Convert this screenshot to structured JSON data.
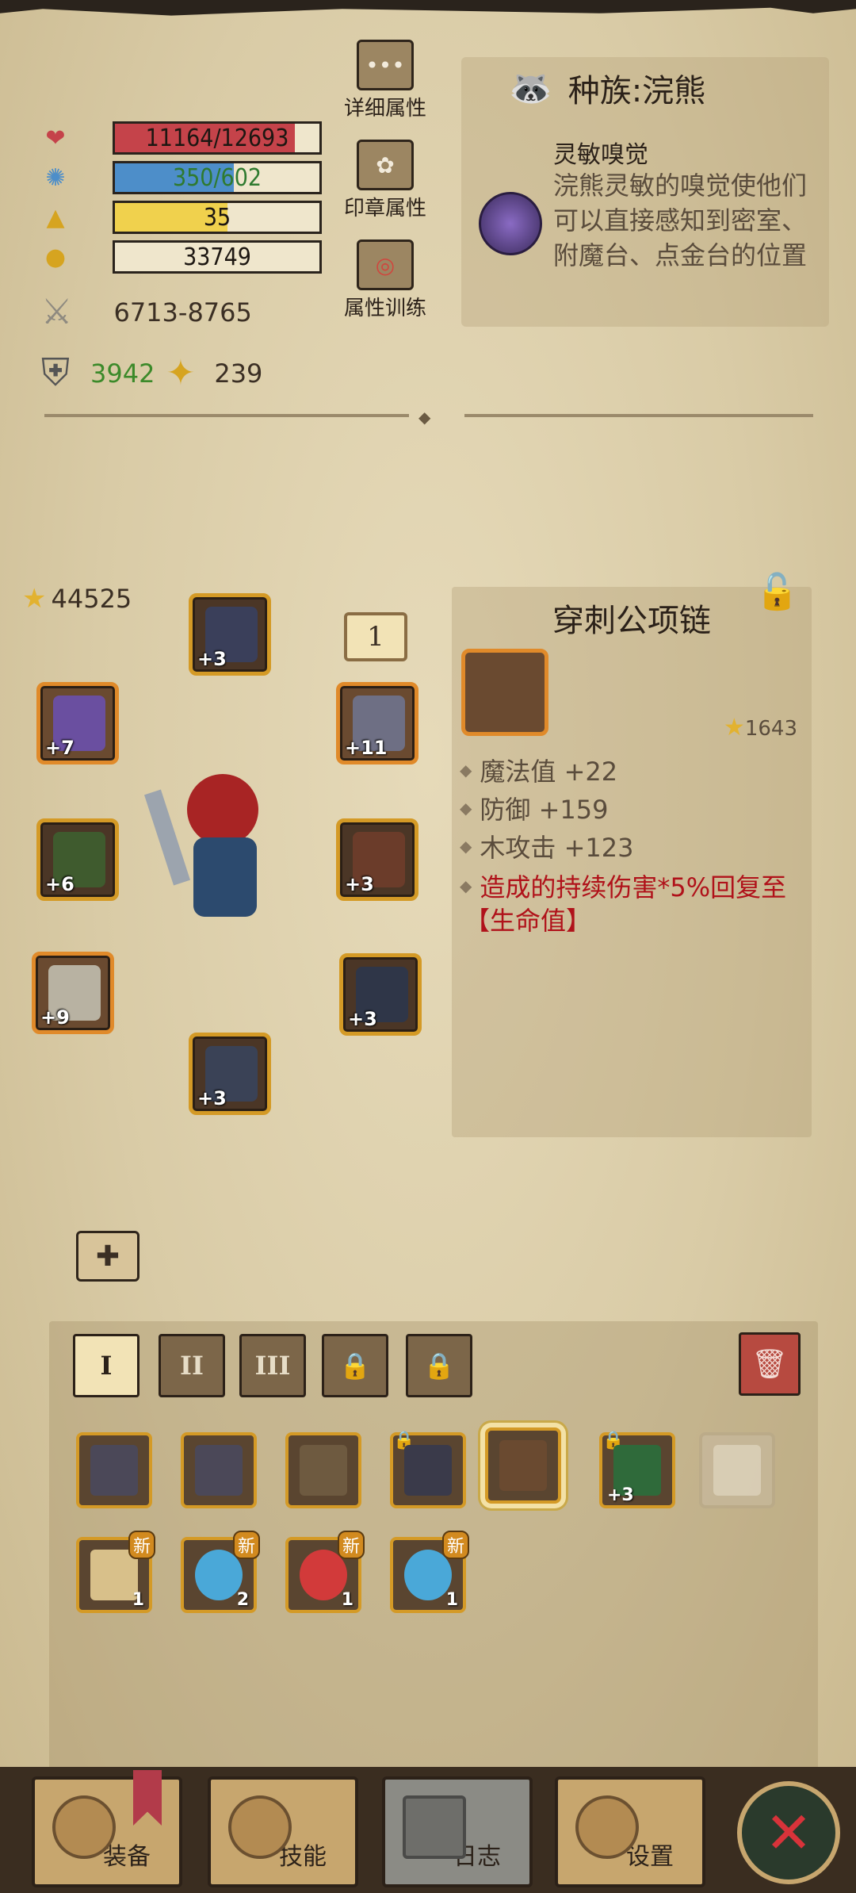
{
  "stats": {
    "hp": {
      "text": "11164/12693",
      "fraction": 0.88,
      "color": "#c5434a"
    },
    "mp": {
      "text": "350/602",
      "fraction": 0.58,
      "color": "#4d8ec9"
    },
    "level": {
      "text": "35",
      "fraction": 0.55,
      "color": "#f0d14d"
    },
    "gold": {
      "text": "33749",
      "fraction": 0,
      "color": "#efe6cc"
    },
    "attack": "6713-8765",
    "defense": "3942",
    "luck": "239"
  },
  "menu": {
    "detail": "详细属性",
    "seal": "印章属性",
    "train": "属性训练"
  },
  "race": {
    "title": "种族:浣熊",
    "skill_name": "灵敏嗅觉",
    "skill_desc": "浣熊灵敏的嗅觉使他们可以直接感知到密室、附魔台、点金台的位置"
  },
  "equip": {
    "power": "44525",
    "page_num": "1",
    "slots": {
      "helmet": "+3",
      "ring": "+7",
      "shoulder": "+11",
      "weapon": "+6",
      "armor": "+3",
      "offhand": "+9",
      "pants": "+3",
      "boots": "+3"
    }
  },
  "detail": {
    "title": "穿刺公项链",
    "score": "1643",
    "attrs": [
      "魔法值 +22",
      "防御 +159",
      "木攻击 +123"
    ],
    "special": "造成的持续伤害*5%回复至",
    "special2": "【生命值】"
  },
  "bag": {
    "tabs": [
      "I",
      "II",
      "III"
    ],
    "row2_counts": [
      "1",
      "2",
      "1",
      "1"
    ],
    "new_label": "新",
    "plus_label": "+3"
  },
  "nav": {
    "equip": "装备",
    "skill": "技能",
    "log": "日志",
    "settings": "设置"
  },
  "icons": {
    "close": "✕",
    "lock": "🔒",
    "trash": "🗑"
  }
}
